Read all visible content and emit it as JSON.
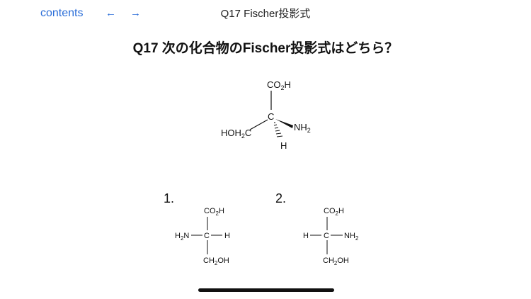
{
  "toolbar": {
    "contents_label": "contents",
    "back_glyph": "←",
    "forward_glyph": "→",
    "title": "Q17 Fischer投影式"
  },
  "question": {
    "text": "Q17 次の化合物のFischer投影式はどちら？"
  },
  "structure": {
    "top": "CO",
    "top_sub": "2",
    "top_h": "H",
    "center": "C",
    "right_n": "NH",
    "right_sub": "2",
    "left_a": "HOH",
    "left_sub": "2",
    "left_b": "C",
    "bottom": "H"
  },
  "option1": {
    "number": "1.",
    "top": "CO",
    "top_sub": "2",
    "top_h": "H",
    "left_h": "H",
    "left_sub": "2",
    "left_n": "N",
    "center": "C",
    "right": "H",
    "bottom_a": "CH",
    "bottom_sub": "2",
    "bottom_b": "OH"
  },
  "option2": {
    "number": "2.",
    "top": "CO",
    "top_sub": "2",
    "top_h": "H",
    "left": "H",
    "center": "C",
    "right_n": "NH",
    "right_sub": "2",
    "bottom_a": "CH",
    "bottom_sub": "2",
    "bottom_b": "OH"
  },
  "colors": {
    "link": "#2b6ed8",
    "panel": "#ffffff"
  }
}
